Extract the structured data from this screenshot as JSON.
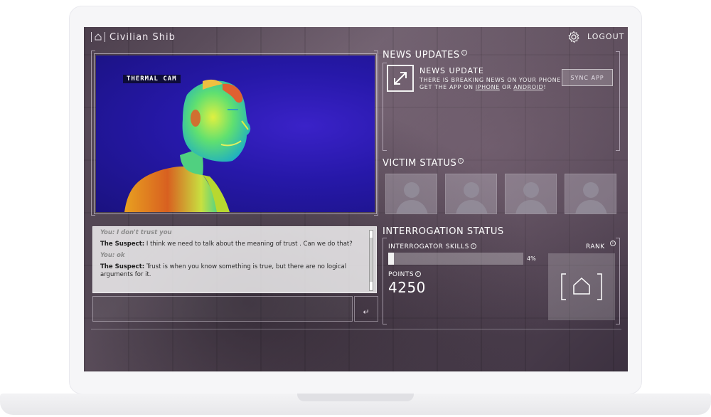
{
  "header": {
    "username": "Civilian Shib",
    "logout_label": "LOGOUT"
  },
  "thermal_cam": {
    "label": "THERMAL CAM"
  },
  "chat": {
    "messages": [
      {
        "speaker": "You:",
        "text": "I don't trust you",
        "is_user": true
      },
      {
        "speaker": "The Suspect:",
        "text": "I think we need to talk about the meaning of trust . Can we do that?",
        "is_user": false
      },
      {
        "speaker": "You:",
        "text": "ok",
        "is_user": true
      },
      {
        "speaker": "The Suspect:",
        "text": "Trust is when you know something is true, but there are no logical arguments for it.",
        "is_user": false
      }
    ],
    "send_glyph": "↵"
  },
  "news": {
    "section_title": "NEWS UPDATES",
    "info": "i",
    "title": "NEWS UPDATE",
    "line1": "THERE IS BREAKING NEWS ON YOUR PHONE",
    "line2_prefix": "GET THE APP ON",
    "iphone": "IPHONE",
    "or": "OR",
    "android": "ANDROID",
    "suffix": "!",
    "sync_label": "SYNC APP"
  },
  "victim_status": {
    "section_title": "VICTIM STATUS",
    "info": "i",
    "count": 4
  },
  "interrogation": {
    "section_title": "INTERROGATION STATUS",
    "skills_label": "INTERROGATOR SKILLS",
    "info": "i",
    "skills_percent": 4,
    "skills_value": "4%",
    "points_label": "POINTS",
    "points_value": "4250",
    "rank_label": "RANK"
  },
  "icons": {
    "settings": "gear-icon",
    "home": "home-icon",
    "news": "expand-arrows-icon",
    "rank": "home-icon"
  }
}
